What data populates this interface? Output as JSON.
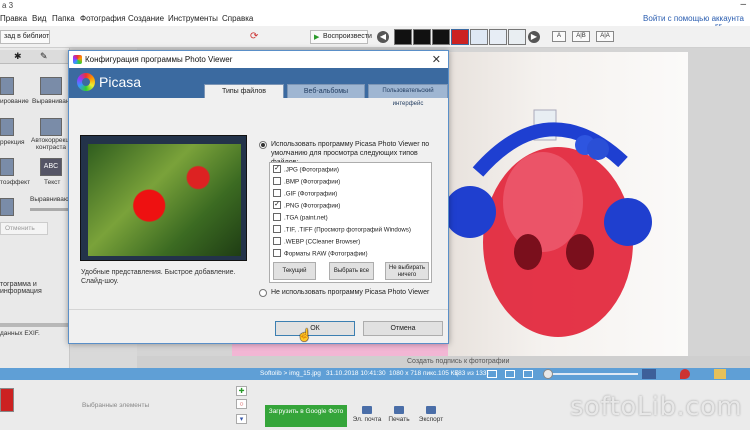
{
  "window": {
    "title_fragment": "a 3",
    "help_link": "Войти с помощью аккаунта",
    "user_link": "ss"
  },
  "menu": [
    "Правка",
    "Вид",
    "Папка",
    "Фотография",
    "Создание",
    "Инструменты",
    "Справка"
  ],
  "toolbar": {
    "library_label": "зад в библиотеку",
    "slideshow_label": "Воспроизвести",
    "text_size_buttons": [
      "A",
      "A|B",
      "A|A"
    ]
  },
  "left_panel": {
    "tools": [
      {
        "label": "ирование"
      },
      {
        "label": "Выравнивание"
      },
      {
        "label": "ррекция"
      },
      {
        "label": "Автокоррекция контраста"
      },
      {
        "label": "тоэффект"
      },
      {
        "label": "Текст"
      }
    ],
    "text_tile_label": "ABC",
    "slider_label": "Выравнивающ",
    "cancel_label": "Отменить",
    "histogram_section": "тограмма и информация",
    "exif_note": "данных EXIF."
  },
  "dialog": {
    "title": "Конфигурация программы Photo Viewer",
    "logo": "Picasa",
    "tabs": [
      "Типы файлов",
      "Веб-альбомы",
      "Пользовательский интерфейс"
    ],
    "active_tab": "Типы файлов",
    "preview_description": "Удобные представления. Быстрое добавление. Слайд-шоу.",
    "option_use": "Использовать программу Picasa Photo Viewer по умолчанию для просмотра следующих типов файлов:",
    "option_not_use": "Не использовать программу Picasa Photo Viewer",
    "file_types": [
      {
        "label": ".JPG (Фотографии)",
        "checked": true
      },
      {
        "label": ".BMP (Фотографии)",
        "checked": false
      },
      {
        "label": ".GIF (Фотографии)",
        "checked": false
      },
      {
        "label": ".PNG (Фотографии)",
        "checked": true
      },
      {
        "label": ".TGA (paint.net)",
        "checked": false
      },
      {
        "label": ".TIF, .TIFF (Просмотр фотографий Windows)",
        "checked": false
      },
      {
        "label": ".WEBP (CCleaner Browser)",
        "checked": false
      },
      {
        "label": "Форматы RAW (Фотографии)",
        "checked": false
      }
    ],
    "btn_current": "Текущий",
    "btn_select_all": "Выбрать все",
    "btn_select_none": "Не выбирать ничего",
    "ok": "ОК",
    "cancel": "Отмена"
  },
  "caption_placeholder": "Создать подпись к фотографии",
  "status": {
    "path": "Softolib > img_15.jpg",
    "datetime": "31.10.2018 10:41:30",
    "dimensions": "1080 x 718 пикс.",
    "size": "105 КБ",
    "index": "(83 из 133)"
  },
  "bottom": {
    "selected_label": "Выбранные элементы",
    "upload_label": "Загрузить в Google Фото",
    "actions": [
      "Эл. почта",
      "Печать",
      "Экспорт"
    ]
  },
  "watermark": "softoLib.com",
  "colors": {
    "status_bar": "#5f9fd6",
    "upload_button": "#35a53a",
    "dialog_header": "#3b6aa0"
  }
}
